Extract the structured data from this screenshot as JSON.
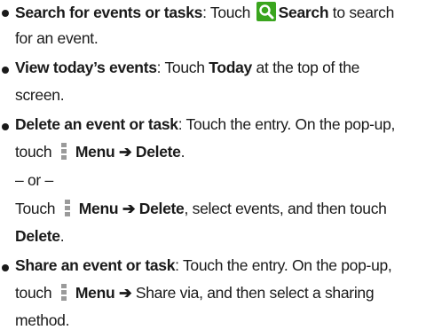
{
  "items": [
    {
      "title": "Search for events or tasks",
      "text1": ": Touch ",
      "icon": "search-icon",
      "bold1": "Search",
      "text2": " to search",
      "line2": "for an event."
    },
    {
      "title": "View today’s events",
      "text1": ": Touch ",
      "bold1": "Today",
      "text2": " at the top of the",
      "line2": "screen."
    },
    {
      "title": "Delete an event or task",
      "text1": ": Touch the entry. On the pop-up,",
      "line2_text": "touch ",
      "menu_label": "Menu",
      "arrow": "➔",
      "delete_label": "Delete",
      "period": ".",
      "or_text": "– or –",
      "line4_text": "Touch ",
      "line4_after": ", select events, and then touch",
      "line5_bold": "Delete",
      "line5_after": "."
    },
    {
      "title": "Share an event or task",
      "text1": ": Touch the entry. On the pop-up,",
      "line2_text": "touch ",
      "menu_label": "Menu",
      "arrow": "➔",
      "share_text": " Share via, and then select a sharing",
      "line3": "method."
    }
  ],
  "colors": {
    "search_icon_bg": "#3aa51e",
    "menu_icon": "#9a9a9a"
  }
}
